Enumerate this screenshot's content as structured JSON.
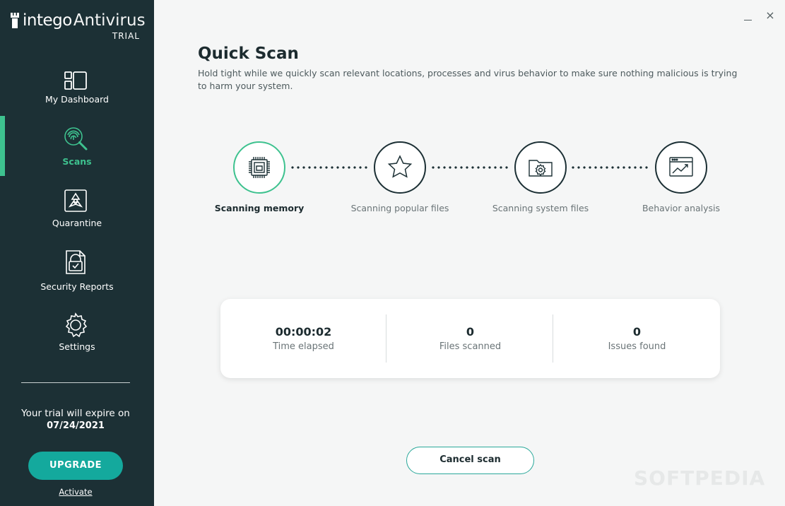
{
  "app": {
    "brand": "intego",
    "product": "Antivirus",
    "edition": "TRIAL"
  },
  "window": {
    "close_glyph": "×"
  },
  "sidebar": {
    "items": [
      {
        "label": "My Dashboard",
        "icon": "dashboard-icon"
      },
      {
        "label": "Scans",
        "icon": "fingerprint-scan-icon",
        "active": true
      },
      {
        "label": "Quarantine",
        "icon": "biohazard-icon"
      },
      {
        "label": "Security Reports",
        "icon": "report-icon"
      },
      {
        "label": "Settings",
        "icon": "gear-icon"
      }
    ],
    "trial_text": "Your trial will expire on",
    "trial_date": "07/24/2021",
    "upgrade_label": "UPGRADE",
    "activate_label": "Activate"
  },
  "main": {
    "title": "Quick Scan",
    "subtitle": "Hold tight while we quickly scan relevant locations, processes and virus behavior to make sure nothing malicious is trying to harm your system.",
    "steps": [
      {
        "label": "Scanning memory",
        "icon": "memory-chip-icon",
        "state": "current"
      },
      {
        "label": "Scanning popular files",
        "icon": "star-icon",
        "state": "pending"
      },
      {
        "label": "Scanning system files",
        "icon": "system-folder-icon",
        "state": "pending"
      },
      {
        "label": "Behavior analysis",
        "icon": "behavior-chart-icon",
        "state": "pending"
      }
    ],
    "stats": [
      {
        "value": "00:00:02",
        "caption": "Time elapsed"
      },
      {
        "value": "0",
        "caption": "Files scanned"
      },
      {
        "value": "0",
        "caption": "Issues found"
      }
    ],
    "cancel_label": "Cancel scan"
  },
  "watermark": "SOFTPEDIA",
  "colors": {
    "sidebar_bg": "#1c3035",
    "accent_green": "#3ec28f",
    "upgrade_teal": "#14a99d",
    "page_bg": "#f5f6f6"
  }
}
